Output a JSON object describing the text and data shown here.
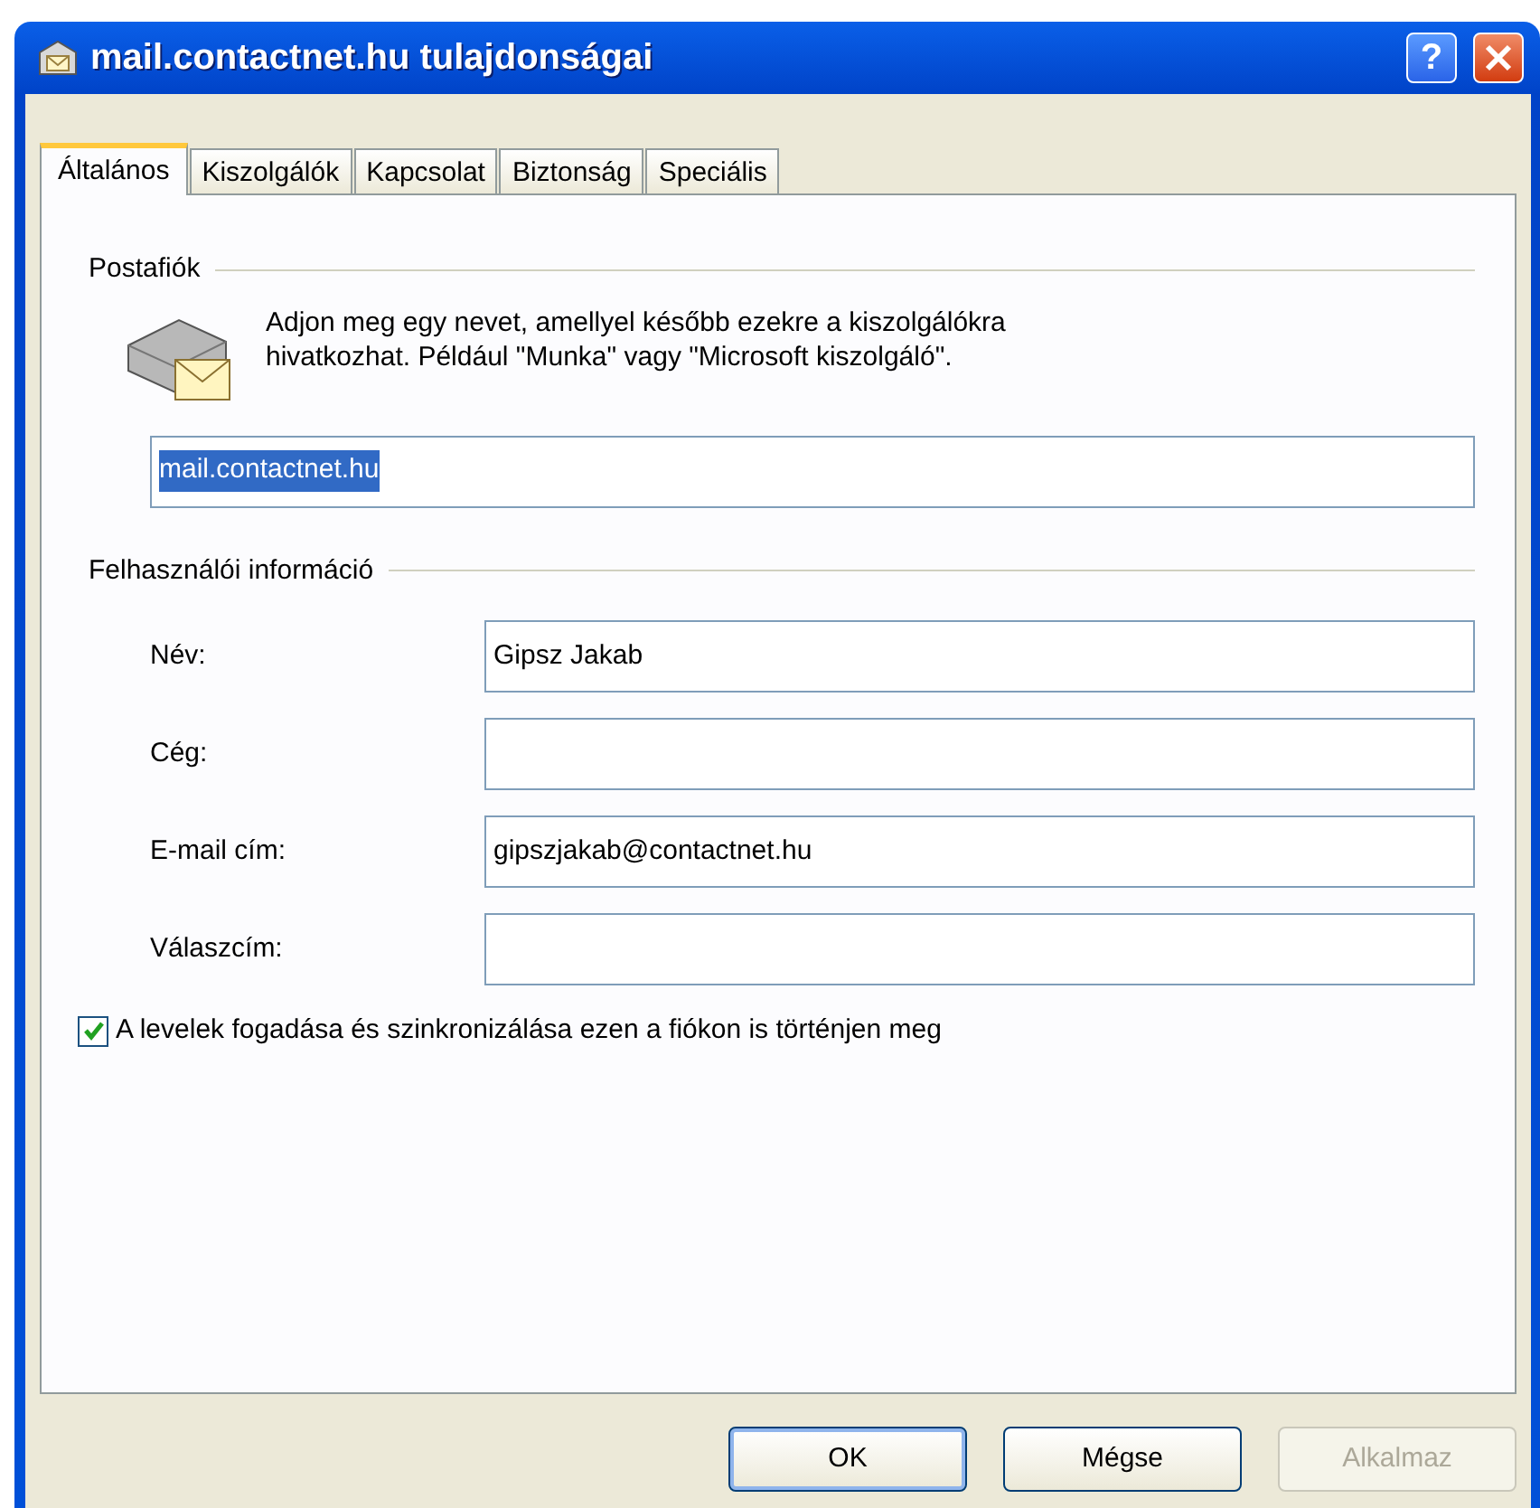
{
  "window": {
    "title": "mail.contactnet.hu tulajdonságai",
    "help_label": "?"
  },
  "tabs": [
    {
      "label": "Általános",
      "selected": true
    },
    {
      "label": "Kiszolgálók",
      "selected": false
    },
    {
      "label": "Kapcsolat",
      "selected": false
    },
    {
      "label": "Biztonság",
      "selected": false
    },
    {
      "label": "Speciális",
      "selected": false
    }
  ],
  "mailbox": {
    "group_label": "Postafiók",
    "description": "Adjon meg egy nevet, amellyel később ezekre a kiszolgálókra hivatkozhat. Például \"Munka\" vagy \"Microsoft kiszolgáló\".",
    "account_name": "mail.contactnet.hu",
    "account_name_highlighted": true
  },
  "user_info": {
    "group_label": "Felhasználói információ",
    "fields": [
      {
        "label": "Név:",
        "value": "Gipsz Jakab"
      },
      {
        "label": "Cég:"
      },
      {
        "label": "E-mail cím:",
        "value": "gipszjakab@contactnet.hu"
      },
      {
        "label": "Válaszcím:"
      }
    ]
  },
  "sync_checkbox": {
    "label": "A levelek fogadása és szinkronizálása ezen a fiókon is történjen meg",
    "checked": true
  },
  "buttons": [
    {
      "label": "OK",
      "default": true,
      "disabled": false
    },
    {
      "label": "Mégse",
      "default": false,
      "disabled": false
    },
    {
      "label": "Alkalmaz",
      "default": false,
      "disabled": true
    }
  ]
}
